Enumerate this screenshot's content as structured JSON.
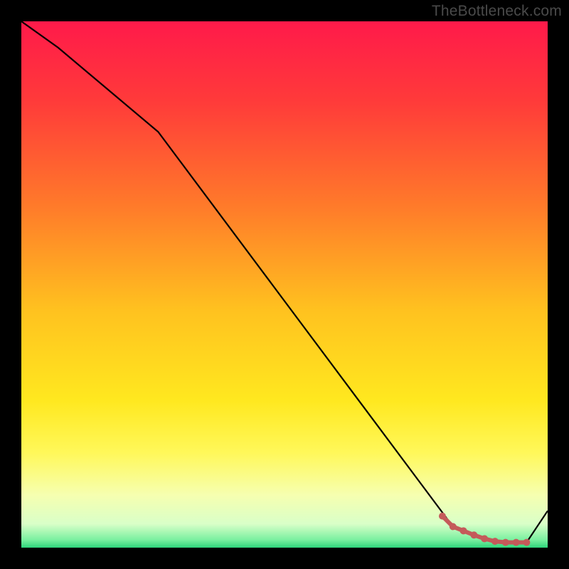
{
  "watermark": "TheBottleneck.com",
  "chart_data": {
    "type": "line",
    "title": "",
    "xlabel": "",
    "ylabel": "",
    "xlim": [
      0,
      100
    ],
    "ylim": [
      0,
      100
    ],
    "series": [
      {
        "name": "main-curve",
        "color": "#000000",
        "x": [
          0,
          7,
          26,
          82,
          90,
          96,
          100
        ],
        "y": [
          100,
          95,
          79,
          4,
          1,
          1,
          7
        ]
      }
    ],
    "highlight": {
      "name": "highlight-segment",
      "color": "#c45a5a",
      "x": [
        80,
        82,
        84,
        86,
        88,
        90,
        92,
        94,
        96
      ],
      "y": [
        6,
        4,
        3.2,
        2.4,
        1.7,
        1.2,
        1.0,
        1.0,
        1.0
      ]
    },
    "gradient_stops": [
      {
        "offset": 0.0,
        "color": "#ff1a4a"
      },
      {
        "offset": 0.15,
        "color": "#ff3a3a"
      },
      {
        "offset": 0.35,
        "color": "#ff7a2a"
      },
      {
        "offset": 0.55,
        "color": "#ffc21f"
      },
      {
        "offset": 0.72,
        "color": "#ffe81f"
      },
      {
        "offset": 0.82,
        "color": "#fff85a"
      },
      {
        "offset": 0.9,
        "color": "#f6ffb0"
      },
      {
        "offset": 0.955,
        "color": "#d9ffc8"
      },
      {
        "offset": 0.985,
        "color": "#7af0a0"
      },
      {
        "offset": 1.0,
        "color": "#2ed47a"
      }
    ]
  }
}
